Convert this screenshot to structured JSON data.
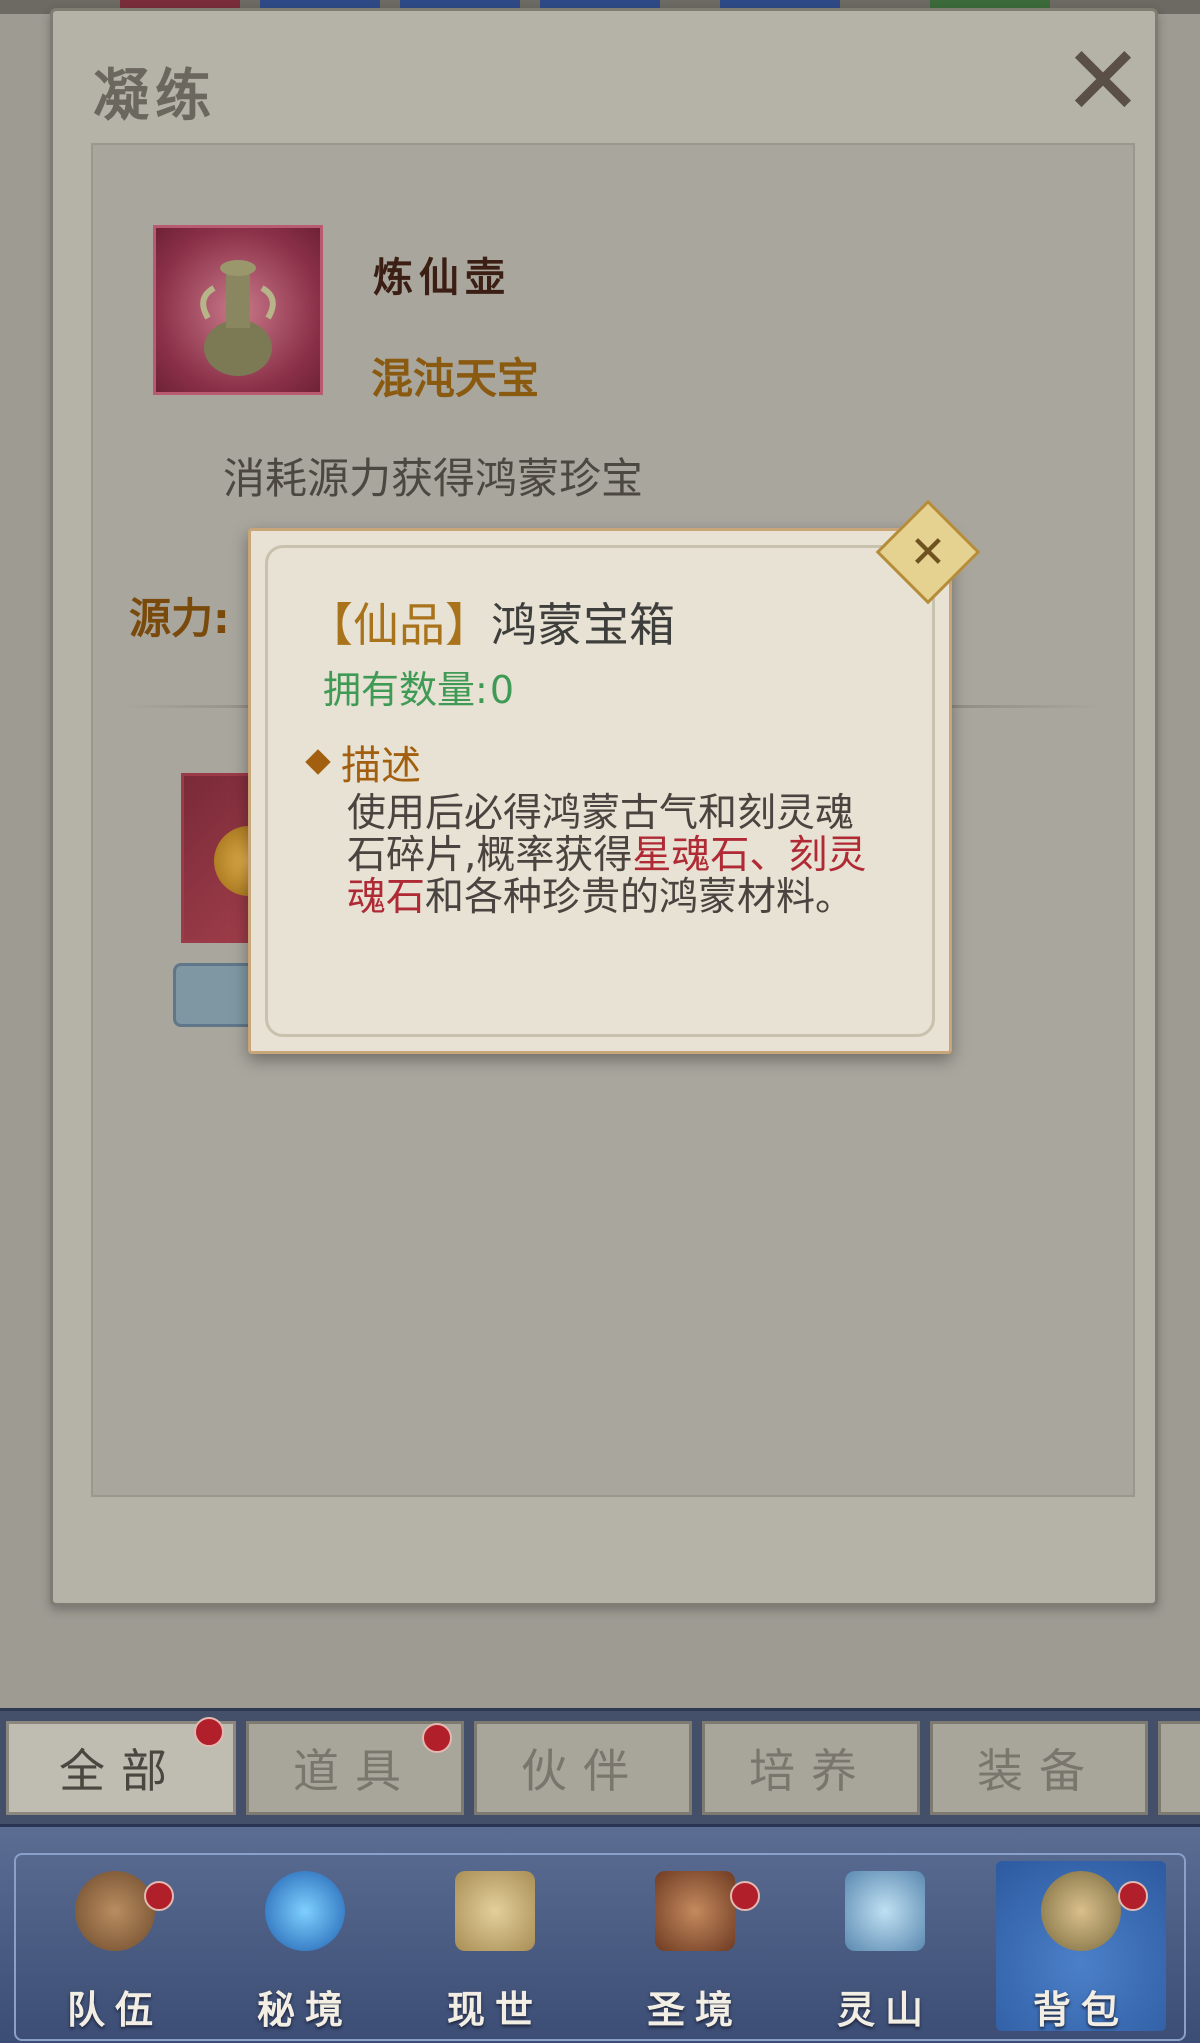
{
  "panel": {
    "title": "凝练",
    "item": {
      "name": "炼仙壶",
      "quality": "混沌天宝",
      "description": "消耗源力获得鸿蒙珍宝"
    },
    "source_label": "源力:"
  },
  "tooltip": {
    "title_bracket_open": "【",
    "title_grade": "仙品",
    "title_bracket_close": "】",
    "title_name": "鸿蒙宝箱",
    "count_label": "拥有数量:",
    "count_value": "0",
    "section_title": "描述",
    "desc_part1": "使用后必得鸿蒙古气和刻灵魂石碎片,概率获得",
    "desc_highlight": "星魂石、刻灵魂石",
    "desc_part2": "和各种珍贵的鸿蒙材料。"
  },
  "tabs": [
    {
      "label": "全部",
      "active": true,
      "badge": true
    },
    {
      "label": "道具",
      "active": false,
      "badge": true
    },
    {
      "label": "伙伴",
      "active": false,
      "badge": false
    },
    {
      "label": "培养",
      "active": false,
      "badge": false
    },
    {
      "label": "装备",
      "active": false,
      "badge": false
    }
  ],
  "nav": [
    {
      "label": "队伍",
      "icon": "team-icon",
      "badge": true
    },
    {
      "label": "秘境",
      "icon": "secret-realm-icon",
      "badge": false
    },
    {
      "label": "现世",
      "icon": "world-scroll-icon",
      "badge": false
    },
    {
      "label": "圣境",
      "icon": "sacred-realm-icon",
      "badge": true
    },
    {
      "label": "灵山",
      "icon": "spirit-mountain-icon",
      "badge": false
    },
    {
      "label": "背包",
      "icon": "backpack-icon",
      "badge": true,
      "active": true
    }
  ],
  "colors": {
    "accent_gold": "#a25f0f",
    "count_green": "#3f9a55",
    "highlight_red": "#b02a36",
    "badge_red": "#b01f2a"
  }
}
